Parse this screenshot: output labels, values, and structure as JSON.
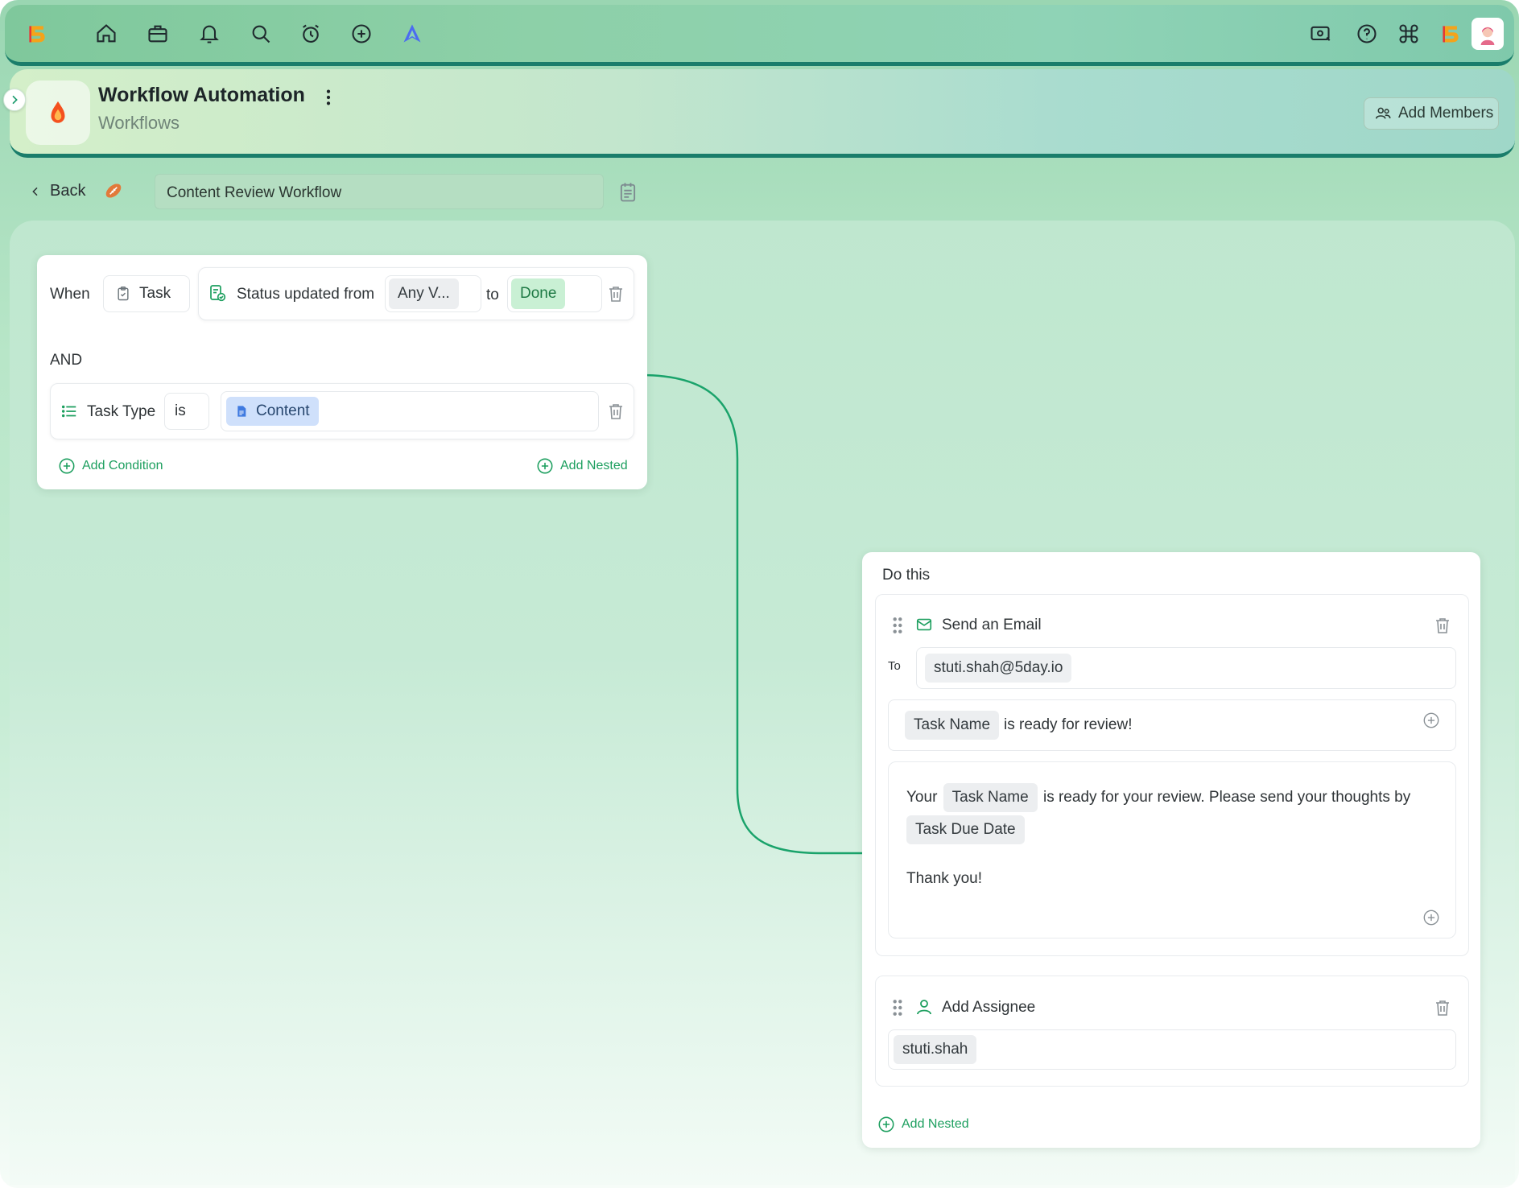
{
  "header": {
    "title": "Workflow Automation",
    "subtitle": "Workflows",
    "add_members_label": "Add Members"
  },
  "toolbar": {
    "back_label": "Back",
    "workflow_name": "Content Review Workflow"
  },
  "trigger": {
    "when_label": "When",
    "entity_label": "Task",
    "event_label": "Status updated from",
    "from_value": "Any V...",
    "to_label": "to",
    "to_value": "Done",
    "and_label": "AND",
    "condition_field": "Task Type",
    "condition_op": "is",
    "condition_value": "Content",
    "add_condition_label": "Add Condition",
    "add_nested_label": "Add Nested"
  },
  "action": {
    "title": "Do this",
    "email": {
      "title": "Send an Email",
      "to_label": "To",
      "to_value": "stuti.shah@5day.io",
      "subject_token": "Task Name",
      "subject_text": "is ready for review!",
      "body_prefix": "Your",
      "body_token_1": "Task Name",
      "body_text": "is ready for your review. Please send your thoughts by",
      "body_token_2": "Task Due Date",
      "body_closing": "Thank you!"
    },
    "assignee": {
      "title": "Add Assignee",
      "value": "stuti.shah"
    },
    "add_nested_label": "Add Nested"
  },
  "colors": {
    "accent_green": "#1d9f5f",
    "done_chip": "#c9f0d4",
    "content_chip": "#cfe0fb",
    "top_border": "#1a7d6b"
  }
}
